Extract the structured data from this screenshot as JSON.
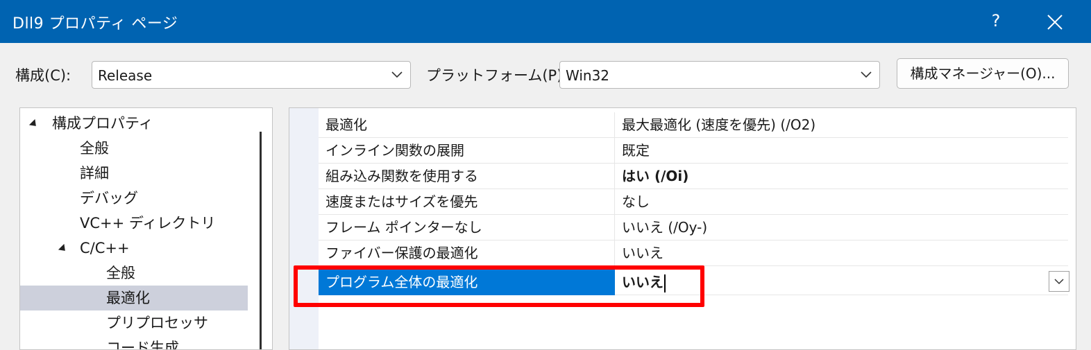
{
  "window": {
    "title": "Dll9 プロパティ ページ",
    "help_label": "?",
    "close_icon": "close-icon"
  },
  "toolbar": {
    "config_label": "構成(C):",
    "config_value": "Release",
    "platform_label": "プラットフォーム(P):",
    "platform_value": "Win32",
    "config_manager_label": "構成マネージャー(O)..."
  },
  "tree": {
    "items": [
      {
        "label": "構成プロパティ",
        "expanded": true
      },
      {
        "label": "全般"
      },
      {
        "label": "詳細"
      },
      {
        "label": "デバッグ"
      },
      {
        "label": "VC++ ディレクトリ"
      },
      {
        "label": "C/C++",
        "expanded": true
      },
      {
        "label": "全般"
      },
      {
        "label": "最適化",
        "selected": true
      },
      {
        "label": "プリプロセッサ"
      },
      {
        "label": "コード生成"
      }
    ]
  },
  "properties": {
    "rows": [
      {
        "name": "最適化",
        "value": "最大最適化 (速度を優先) (/O2)"
      },
      {
        "name": "インライン関数の展開",
        "value": "既定"
      },
      {
        "name": "組み込み関数を使用する",
        "value": "はい (/Oi)",
        "bold": true
      },
      {
        "name": "速度またはサイズを優先",
        "value": "なし"
      },
      {
        "name": "フレーム ポインターなし",
        "value": "いいえ (/Oy-)"
      },
      {
        "name": "ファイバー保護の最適化",
        "value": "いいえ"
      },
      {
        "name": "プログラム全体の最適化",
        "value": "いいえ",
        "bold": true,
        "selected": true
      }
    ]
  },
  "colors": {
    "titlebar": "#0063b1",
    "selection": "#0078d7",
    "annotation": "#ff0000"
  }
}
